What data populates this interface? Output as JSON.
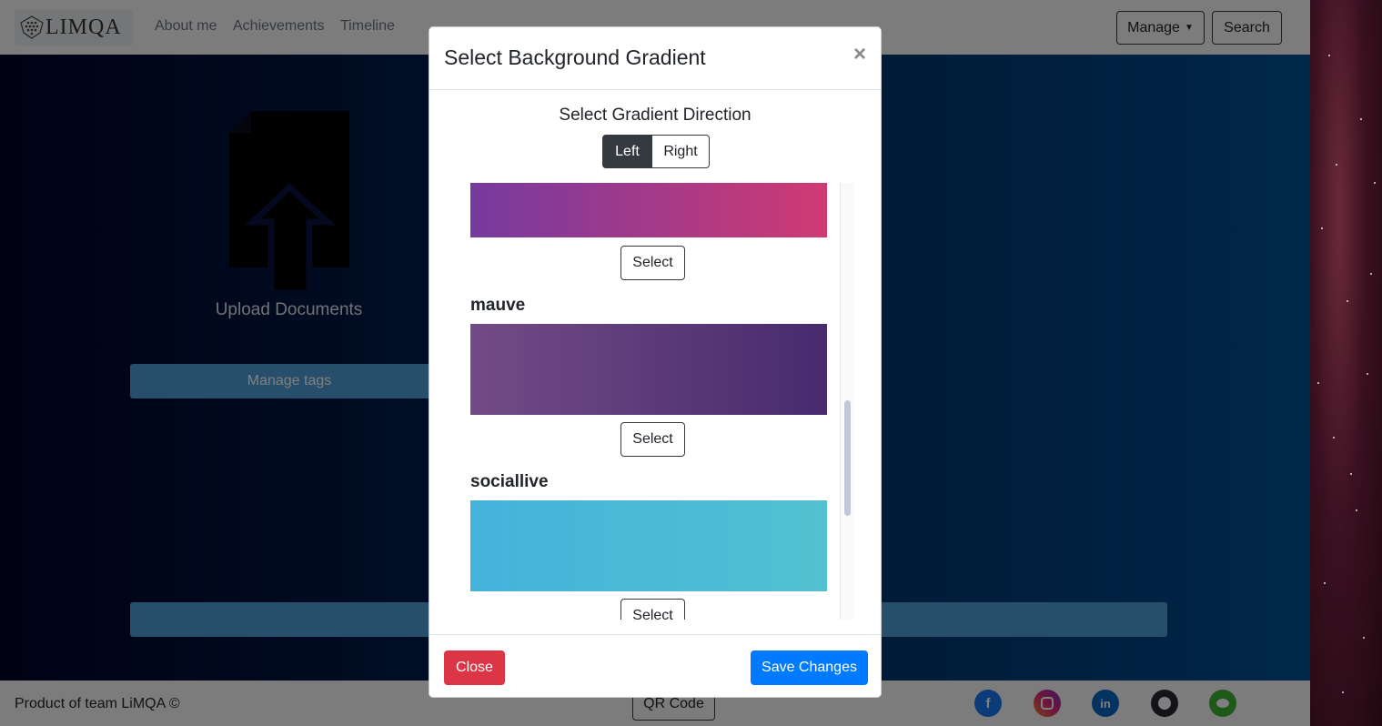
{
  "navbar": {
    "brand": "LIMQA",
    "links": [
      "About me",
      "Achievements",
      "Timeline"
    ],
    "manage_label": "Manage",
    "search_label": "Search"
  },
  "main": {
    "upload_label": "Upload Documents",
    "manage_tags_label": "Manage tags"
  },
  "footer": {
    "text": "Product of team LiMQA ©",
    "qr_label": "QR Code",
    "socials": [
      "facebook-icon",
      "instagram-icon",
      "linkedin-icon",
      "github-icon",
      "wechat-icon"
    ]
  },
  "modal": {
    "title": "Select Background Gradient",
    "close_symbol": "×",
    "direction_heading": "Select Gradient Direction",
    "direction_options": [
      "Left",
      "Right"
    ],
    "direction_selected": "Left",
    "gradients": [
      {
        "name": "",
        "colors": [
          "#753a9f",
          "#d03a73"
        ],
        "select_label": "Select"
      },
      {
        "name": "mauve",
        "colors": [
          "#734b86",
          "#472b6e"
        ],
        "select_label": "Select"
      },
      {
        "name": "sociallive",
        "colors": [
          "#45b2dc",
          "#52c1d0"
        ],
        "select_label": "Select"
      }
    ],
    "close_label": "Close",
    "save_label": "Save Changes"
  },
  "colors": {
    "background_gradient": [
      "#000428",
      "#004e92"
    ],
    "close_button": "#dc3545",
    "save_button": "#007bff",
    "selected_direction": "#343a40"
  }
}
